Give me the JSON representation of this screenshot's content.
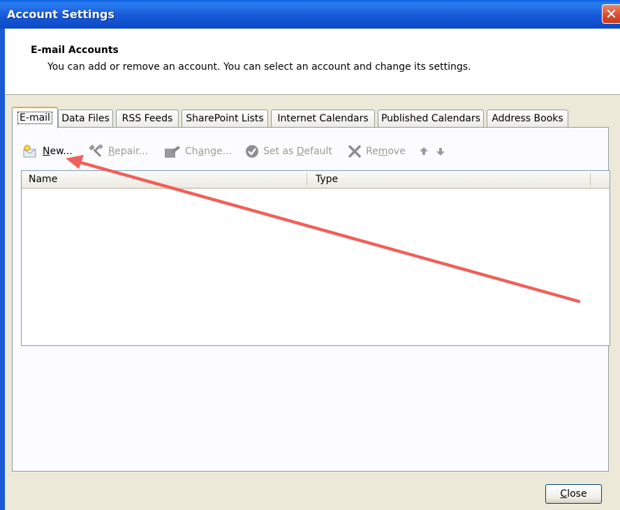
{
  "window": {
    "title": "Account Settings",
    "close_glyph": "✕"
  },
  "header": {
    "title": "E-mail Accounts",
    "description": "You can add or remove an account. You can select an account and change its settings."
  },
  "tabs": [
    {
      "label": "E-mail",
      "active": true
    },
    {
      "label": "Data Files"
    },
    {
      "label": "RSS Feeds"
    },
    {
      "label": "SharePoint Lists"
    },
    {
      "label": "Internet Calendars"
    },
    {
      "label": "Published Calendars"
    },
    {
      "label": "Address Books"
    }
  ],
  "toolbar": {
    "new": {
      "pre": "",
      "key": "N",
      "post": "ew...",
      "icon": "new-mail-icon",
      "enabled": true
    },
    "repair": {
      "pre": "",
      "key": "R",
      "post": "epair...",
      "icon": "repair-icon",
      "enabled": false
    },
    "change": {
      "pre": "Ch",
      "key": "a",
      "post": "nge...",
      "icon": "change-icon",
      "enabled": false
    },
    "default": {
      "pre": "Set as ",
      "key": "D",
      "post": "efault",
      "icon": "checkmark-icon",
      "enabled": false
    },
    "remove": {
      "pre": "Re",
      "key": "m",
      "post": "ove",
      "icon": "remove-x-icon",
      "enabled": false
    },
    "up_icon": "move-up-arrow-icon",
    "down_icon": "move-down-arrow-icon"
  },
  "list": {
    "columns": [
      "Name",
      "Type"
    ],
    "rows": []
  },
  "footer": {
    "close_pre": "",
    "close_key": "C",
    "close_post": "lose"
  },
  "annotation": {
    "color": "#f0605a"
  }
}
